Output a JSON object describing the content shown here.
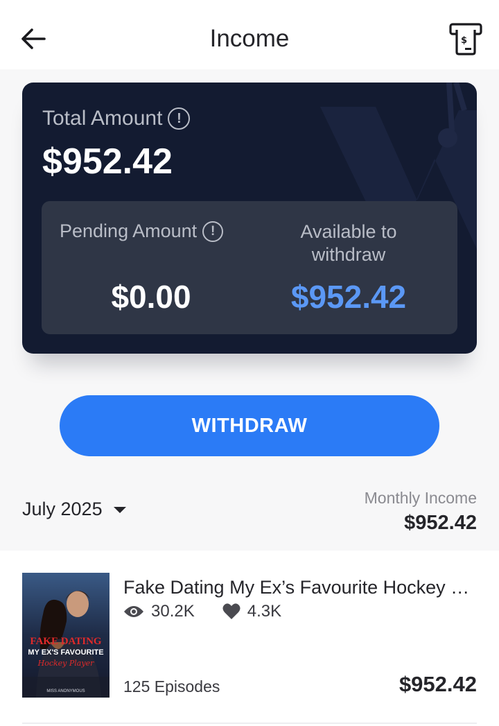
{
  "header": {
    "title": "Income",
    "back_icon": "arrow-left-icon",
    "atm_icon": "atm-cash-icon"
  },
  "summary": {
    "total_label": "Total Amount",
    "total_value": "$952.42",
    "pending_label": "Pending Amount",
    "pending_value": "$0.00",
    "available_label": "Available to withdraw",
    "available_value": "$952.42",
    "info_icon": "info-circle-icon"
  },
  "actions": {
    "withdraw_label": "WITHDRAW"
  },
  "filter": {
    "month": "July 2025",
    "monthly_income_label": "Monthly Income",
    "monthly_income_value": "$952.42"
  },
  "books": [
    {
      "title": "Fake Dating My Ex’s Favourite Hockey Player",
      "views": "30.2K",
      "likes": "4.3K",
      "episodes": "125 Episodes",
      "income": "$952.42",
      "cover_text": {
        "line1": "FAKE DATING",
        "line2": "MY EX'S FAVOURITE",
        "line3": "Hockey Player",
        "author": "MISS ANONYMOUS"
      }
    }
  ],
  "colors": {
    "card_bg": "#131b31",
    "inner_box_bg": "#2f3646",
    "accent_blue": "#2b7bf6",
    "available_blue": "#5b98f5"
  }
}
